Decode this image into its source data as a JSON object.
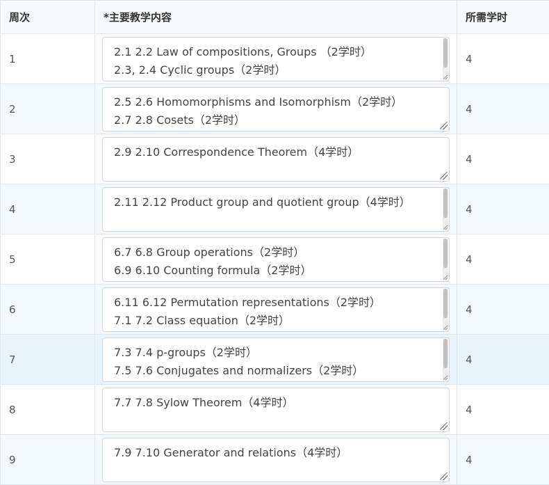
{
  "headers": {
    "week": "周次",
    "content": "*主要教学内容",
    "hours": "所需学时"
  },
  "rows": [
    {
      "week": "1",
      "content": "2.1 2.2 Law of compositions, Groups （2学时）\n2.3, 2.4 Cyclic groups（2学时）",
      "hours": "4"
    },
    {
      "week": "2",
      "content": "2.5 2.6 Homomorphisms and Isomorphism（2学时）\n2.7 2.8 Cosets（2学时）",
      "hours": "4"
    },
    {
      "week": "3",
      "content": "2.9 2.10 Correspondence Theorem（4学时）",
      "hours": "4"
    },
    {
      "week": "4",
      "content": "2.11 2.12 Product group and quotient group（4学时）",
      "hours": "4"
    },
    {
      "week": "5",
      "content": "6.7 6.8 Group operations（2学时）\n6.9 6.10 Counting formula（2学时）",
      "hours": "4"
    },
    {
      "week": "6",
      "content": "6.11 6.12 Permutation representations（2学时）\n7.1 7.2 Class equation（2学时）",
      "hours": "4"
    },
    {
      "week": "7",
      "content": "7.3 7.4 p-groups（2学时）\n7.5 7.6 Conjugates and normalizers（2学时）",
      "hours": "4"
    },
    {
      "week": "8",
      "content": "7.7 7.8 Sylow Theorem（4学时）",
      "hours": "4"
    },
    {
      "week": "9",
      "content": "7.9 7.10 Generator and relations（4学时）",
      "hours": "4"
    }
  ]
}
